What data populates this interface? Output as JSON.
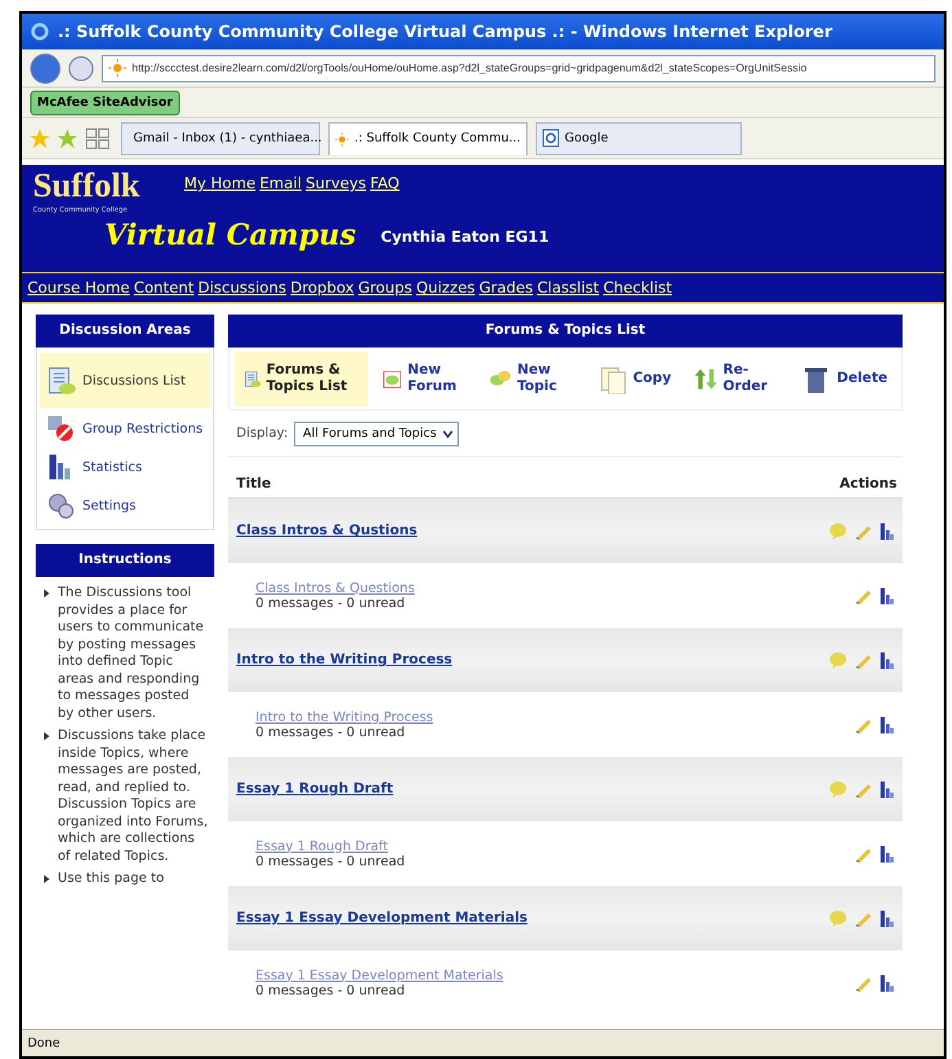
{
  "browser": {
    "title": ".: Suffolk County Community College Virtual Campus .: - Windows Internet Explorer",
    "url": "http://sccctest.desire2learn.com/d2l/orgTools/ouHome/ouHome.asp?d2l_stateGroups=grid~gridpagenum&d2l_stateScopes=OrgUnitSessio",
    "safety_button": "McAfee SiteAdvisor",
    "tabs": [
      {
        "label": "Gmail - Inbox (1) - cynthiaea...",
        "kind": "mail",
        "selected": false
      },
      {
        "label": ".: Suffolk County Commu...",
        "kind": "site",
        "selected": true
      },
      {
        "label": "Google",
        "kind": "search",
        "selected": false
      }
    ],
    "status": "Done"
  },
  "banner": {
    "logo": "Suffolk",
    "logo_sub": "County Community College",
    "campus": "Virtual Campus",
    "user": "Cynthia Eaton EG11",
    "top_links": [
      "My Home",
      "Email",
      "Surveys",
      "FAQ"
    ],
    "nav": [
      "Course Home",
      "Content",
      "Discussions",
      "Dropbox",
      "Groups",
      "Quizzes",
      "Grades",
      "Classlist",
      "Checklist"
    ]
  },
  "sidebar": {
    "areas_title": "Discussion Areas",
    "items": [
      {
        "label": "Discussions List",
        "kind": "list",
        "selected": true
      },
      {
        "label": "Group Restrictions",
        "kind": "restrict",
        "selected": false
      },
      {
        "label": "Statistics",
        "kind": "stats",
        "selected": false
      },
      {
        "label": "Settings",
        "kind": "settings",
        "selected": false
      }
    ],
    "instructions_title": "Instructions",
    "instructions": [
      "The Discussions tool provides a place for users to communicate by posting messages into defined Topic areas and responding to messages posted by other users.",
      "Discussions take place inside Topics, where messages are posted, read, and replied to. Discussion Topics are organized into Forums, which are collections of related Topics.",
      "Use this page to"
    ]
  },
  "main": {
    "title": "Forums & Topics List",
    "toolbar": [
      {
        "label": "Forums & Topics List",
        "kind": "list",
        "selected": true
      },
      {
        "label": "New Forum",
        "kind": "forum",
        "selected": false
      },
      {
        "label": "New Topic",
        "kind": "topic",
        "selected": false
      },
      {
        "label": "Copy",
        "kind": "copy",
        "selected": false
      },
      {
        "label": "Re-Order",
        "kind": "reorder",
        "selected": false
      },
      {
        "label": "Delete",
        "kind": "delete",
        "selected": false
      }
    ],
    "display_label": "Display:",
    "display_value": "All Forums and Topics",
    "columns": [
      "Title",
      "Actions"
    ],
    "forums": [
      {
        "title": "Class Intros & Qustions",
        "topics": [
          {
            "title": "Class Intros & Questions",
            "stats": "0 messages - 0 unread"
          }
        ]
      },
      {
        "title": "Intro to the Writing Process",
        "topics": [
          {
            "title": "Intro to the Writing Process",
            "stats": "0 messages - 0 unread"
          }
        ]
      },
      {
        "title": "Essay 1 Rough Draft",
        "topics": [
          {
            "title": "Essay 1 Rough Draft",
            "stats": "0 messages - 0 unread"
          }
        ]
      },
      {
        "title": "Essay 1 Essay Development Materials",
        "topics": [
          {
            "title": "Essay 1 Essay Development Materials",
            "stats": "0 messages - 0 unread"
          }
        ]
      }
    ]
  }
}
